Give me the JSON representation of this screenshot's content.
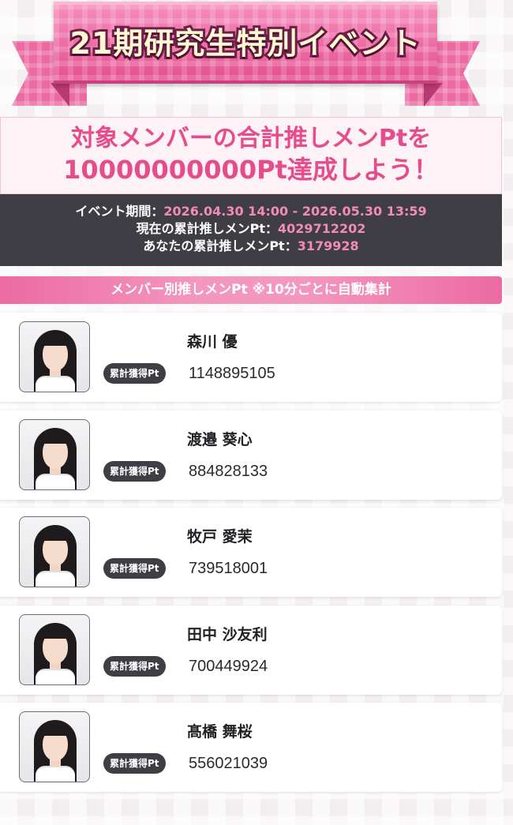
{
  "event": {
    "title": "21期研究生特別イベント",
    "goal_line1": "対象メンバーの合計推しメンPtを",
    "goal_line2": "10000000000Pt達成しよう！"
  },
  "info": {
    "period_label": "イベント期間：",
    "period_value": "2026.04.30 14:00 - 2026.05.30 13:59",
    "current_label": "現在の累計推しメンPt：",
    "current_value": "4029712202",
    "yours_label": "あなたの累計推しメンPt：",
    "yours_value": "3179928"
  },
  "section": {
    "header": "メンバー別推しメンPt ※10分ごとに自動集計"
  },
  "members": [
    {
      "name": "森川 優",
      "badge": "累計獲得Pt",
      "points": "1148895105"
    },
    {
      "name": "渡邉 葵心",
      "badge": "累計獲得Pt",
      "points": "884828133"
    },
    {
      "name": "牧戸 愛茉",
      "badge": "累計獲得Pt",
      "points": "739518001"
    },
    {
      "name": "田中 沙友利",
      "badge": "累計獲得Pt",
      "points": "700449924"
    },
    {
      "name": "髙橋 舞桜",
      "badge": "累計獲得Pt",
      "points": "556021039"
    }
  ],
  "colors": {
    "accent_pink": "#e64c8b",
    "value_pink": "#f28cb5",
    "dark_panel": "#3e3e44"
  }
}
